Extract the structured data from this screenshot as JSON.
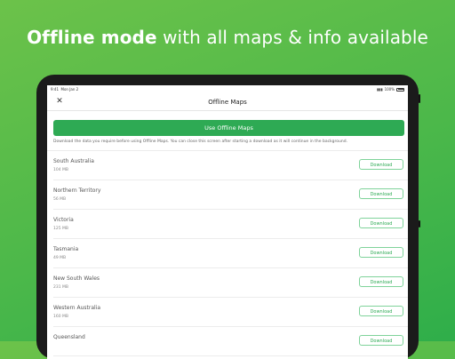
{
  "promo": {
    "bold": "Offline mode",
    "rest": " with all maps & info available"
  },
  "status_bar": {
    "time": "9:41",
    "date": "Mon Jan 2",
    "battery": "100%"
  },
  "nav": {
    "title": "Offline Maps",
    "close_icon": "close-icon"
  },
  "primary_button": "Use Offline Maps",
  "description": "Download the data you require before using Offline Maps. You can close this screen after starting a download as it will continue in the background.",
  "regions": [
    {
      "name": "South Australia",
      "size": "104 MB",
      "action": "Download"
    },
    {
      "name": "Northern Territory",
      "size": "56 MB",
      "action": "Download"
    },
    {
      "name": "Victoria",
      "size": "125 MB",
      "action": "Download"
    },
    {
      "name": "Tasmania",
      "size": "49 MB",
      "action": "Download"
    },
    {
      "name": "New South Wales",
      "size": "231 MB",
      "action": "Download"
    },
    {
      "name": "Western Australia",
      "size": "160 MB",
      "action": "Download"
    },
    {
      "name": "Queensland",
      "size": "",
      "action": "Download"
    }
  ],
  "colors": {
    "accent": "#2eaa54",
    "background": "#4cb84a"
  }
}
